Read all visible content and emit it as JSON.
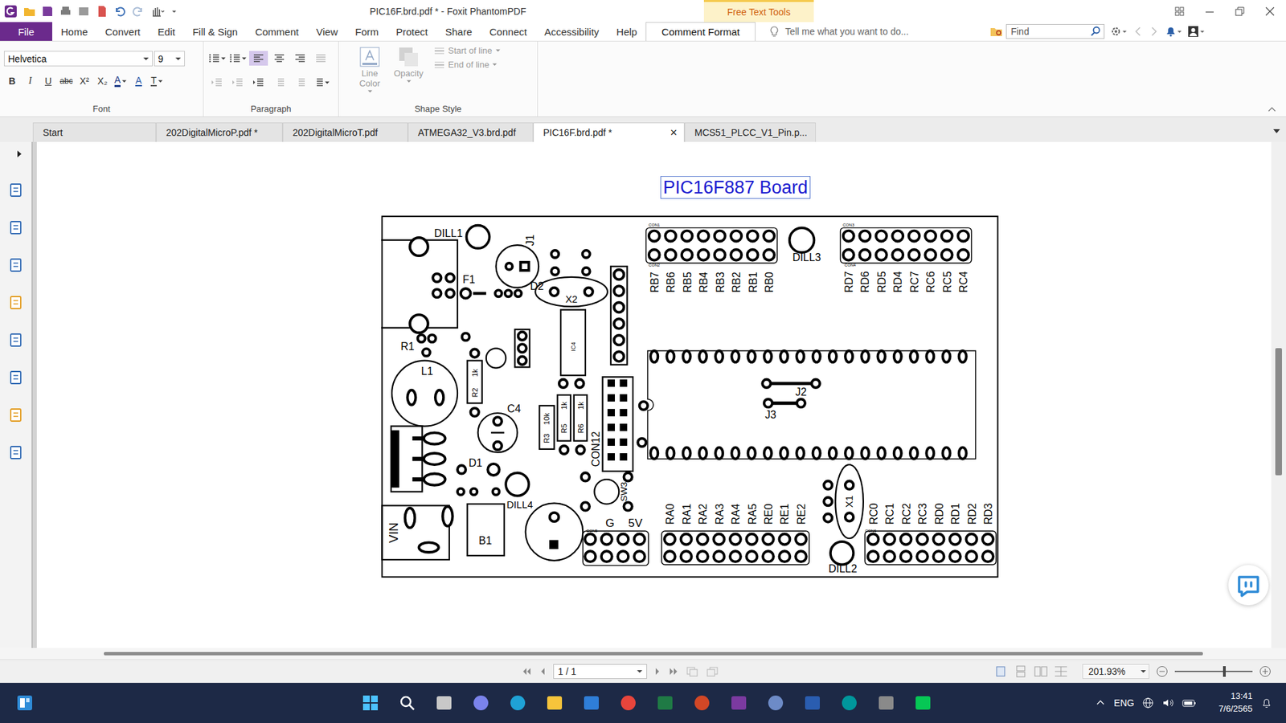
{
  "window": {
    "title": "PIC16F.brd.pdf * - Foxit PhantomPDF",
    "context_tab": "Free Text Tools"
  },
  "ribbon_tabs": [
    {
      "label": "File",
      "kind": "file",
      "selected": false
    },
    {
      "label": "Home",
      "kind": "tab",
      "selected": false
    },
    {
      "label": "Convert",
      "kind": "tab",
      "selected": false
    },
    {
      "label": "Edit",
      "kind": "tab",
      "selected": false
    },
    {
      "label": "Fill & Sign",
      "kind": "tab",
      "selected": false
    },
    {
      "label": "Comment",
      "kind": "tab",
      "selected": false
    },
    {
      "label": "View",
      "kind": "tab",
      "selected": false
    },
    {
      "label": "Form",
      "kind": "tab",
      "selected": false
    },
    {
      "label": "Protect",
      "kind": "tab",
      "selected": false
    },
    {
      "label": "Share",
      "kind": "tab",
      "selected": false
    },
    {
      "label": "Connect",
      "kind": "tab",
      "selected": false
    },
    {
      "label": "Accessibility",
      "kind": "tab",
      "selected": false
    },
    {
      "label": "Help",
      "kind": "tab",
      "selected": false
    },
    {
      "label": "Comment Format",
      "kind": "tab",
      "selected": true
    }
  ],
  "tell_me": {
    "placeholder": "Tell me what you want to do..."
  },
  "search": {
    "placeholder": "Find"
  },
  "font_group": {
    "label": "Font",
    "family": "Helvetica",
    "size": "9",
    "buttons": [
      {
        "label": "B",
        "kind": "bold"
      },
      {
        "label": "I",
        "kind": "italic"
      },
      {
        "label": "U",
        "kind": "underline"
      },
      {
        "label": "abc",
        "kind": "strike"
      },
      {
        "label": "X²",
        "kind": "plain"
      },
      {
        "label": "X₂",
        "kind": "plain"
      },
      {
        "label": "A",
        "kind": "font-color"
      },
      {
        "label": "A",
        "kind": "outline"
      },
      {
        "label": "T",
        "kind": "text-style"
      }
    ]
  },
  "paragraph_group": {
    "label": "Paragraph",
    "buttons": [
      {
        "kind": "bullets",
        "selected": false,
        "disabled": false
      },
      {
        "kind": "numbering",
        "selected": false,
        "disabled": false
      },
      {
        "kind": "align-left",
        "selected": true,
        "disabled": false
      },
      {
        "kind": "align-center",
        "selected": false,
        "disabled": false
      },
      {
        "kind": "align-right",
        "selected": false,
        "disabled": false
      },
      {
        "kind": "justify",
        "selected": false,
        "disabled": true
      },
      {
        "kind": "outdent",
        "selected": false,
        "disabled": true
      },
      {
        "kind": "indent",
        "selected": false,
        "disabled": true
      },
      {
        "kind": "line-spacing",
        "selected": false,
        "disabled": false
      },
      {
        "kind": "para-spacing",
        "selected": false,
        "disabled": true
      },
      {
        "kind": "char-spacing",
        "selected": false,
        "disabled": true
      },
      {
        "kind": "spacing",
        "selected": false,
        "disabled": false
      }
    ]
  },
  "shape_group": {
    "label": "Shape Style",
    "items": [
      {
        "label": "Line Color",
        "kind": "large",
        "disabled": true
      },
      {
        "label": "Opacity",
        "kind": "large",
        "disabled": true
      },
      {
        "label": "Start of line",
        "kind": "small",
        "disabled": true
      },
      {
        "label": "End of line",
        "kind": "small",
        "disabled": true
      }
    ]
  },
  "doc_tabs": {
    "close_glyph": "×",
    "items": [
      {
        "label": "Start",
        "selected": false,
        "closable": false
      },
      {
        "label": "202DigitalMicroP.pdf *",
        "selected": false,
        "closable": false
      },
      {
        "label": "202DigitalMicroT.pdf",
        "selected": false,
        "closable": false
      },
      {
        "label": "ATMEGA32_V3.brd.pdf",
        "selected": false,
        "closable": false
      },
      {
        "label": "PIC16F.brd.pdf *",
        "selected": true,
        "closable": true
      },
      {
        "label": "MCS51_PLCC_V1_Pin.p...",
        "selected": false,
        "closable": false
      }
    ]
  },
  "document": {
    "title": "PIC16F887 Board",
    "headers": [
      {
        "pins": [
          "RB7",
          "RB6",
          "RB5",
          "RB4",
          "RB3",
          "RB2",
          "RB1",
          "RB0"
        ]
      },
      {
        "pins": [
          "RD7",
          "RD6",
          "RD5",
          "RD4",
          "RC7",
          "RC6",
          "RC5",
          "RC4"
        ]
      },
      {
        "pins": [
          "RA0",
          "RA1",
          "RA2",
          "RA3",
          "RA4",
          "RA5",
          "RE0",
          "RE1",
          "RE2"
        ]
      },
      {
        "pins": [
          "RC0",
          "RC1",
          "RC2",
          "RC3",
          "RD0",
          "RD1",
          "RD2",
          "RD3"
        ]
      }
    ],
    "parts": [
      "DILL1",
      "F1",
      "D2",
      "J1",
      "X2",
      "R1",
      "L1",
      "IC4",
      "1k",
      "R2",
      "C4",
      "10k",
      "R3",
      "1k",
      "R5",
      "1k",
      "R6",
      "CON12",
      "D1",
      "DILL4",
      "SW3",
      "VIN",
      "B1",
      "J2",
      "J3",
      "X1",
      "DILL3",
      "DILL2",
      "G",
      "5V",
      "CON1",
      "CON2",
      "CON3",
      "CON4",
      "CON5",
      "CON6"
    ]
  },
  "navigation": {
    "page": "1 / 1",
    "zoom": "201.93%",
    "zoom_level": 0.64
  },
  "taskbar": {
    "language": "ENG",
    "time": "13:41",
    "date": "7/6/2565"
  }
}
